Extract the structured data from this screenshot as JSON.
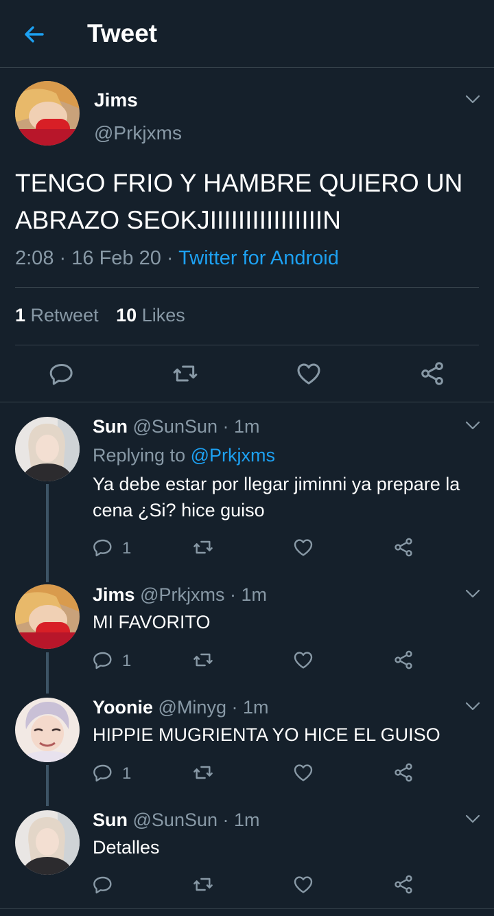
{
  "header": {
    "title": "Tweet",
    "back_icon": "arrow-left-icon"
  },
  "colors": {
    "background": "#15202b",
    "accent": "#1da1f2",
    "muted": "#8899a6",
    "border": "#38444d"
  },
  "main_tweet": {
    "name": "Jims",
    "handle": "@Prkjxms",
    "text": "TENGO FRIO Y HAMBRE QUIERO UN ABRAZO SEOKJIIIIIIIIIIIIIIIIN",
    "time": "2:08",
    "sep1": "·",
    "date": "16 Feb 20",
    "sep2": "·",
    "source": "Twitter for Android",
    "retweets_count": "1",
    "retweets_label": "Retweet",
    "likes_count": "10",
    "likes_label": "Likes"
  },
  "replies": [
    {
      "name": "Sun",
      "handle": "@SunSun",
      "time": "· 1m",
      "replying_label": "Replying to",
      "replying_to": "@Prkjxms",
      "text": "Ya debe estar por llegar jiminni ya prepare la cena ¿Si? hice guiso",
      "reply_count": "1"
    },
    {
      "name": "Jims",
      "handle": "@Prkjxms",
      "time": "· 1m",
      "text": "MI FAVORITO",
      "reply_count": "1"
    },
    {
      "name": "Yoonie",
      "handle": "@Minyg",
      "time": "· 1m",
      "text": "HIPPIE MUGRIENTA YO HICE EL GUISO",
      "reply_count": "1"
    },
    {
      "name": "Sun",
      "handle": "@SunSun",
      "time": "· 1m",
      "text": "Detalles",
      "reply_count": ""
    }
  ]
}
